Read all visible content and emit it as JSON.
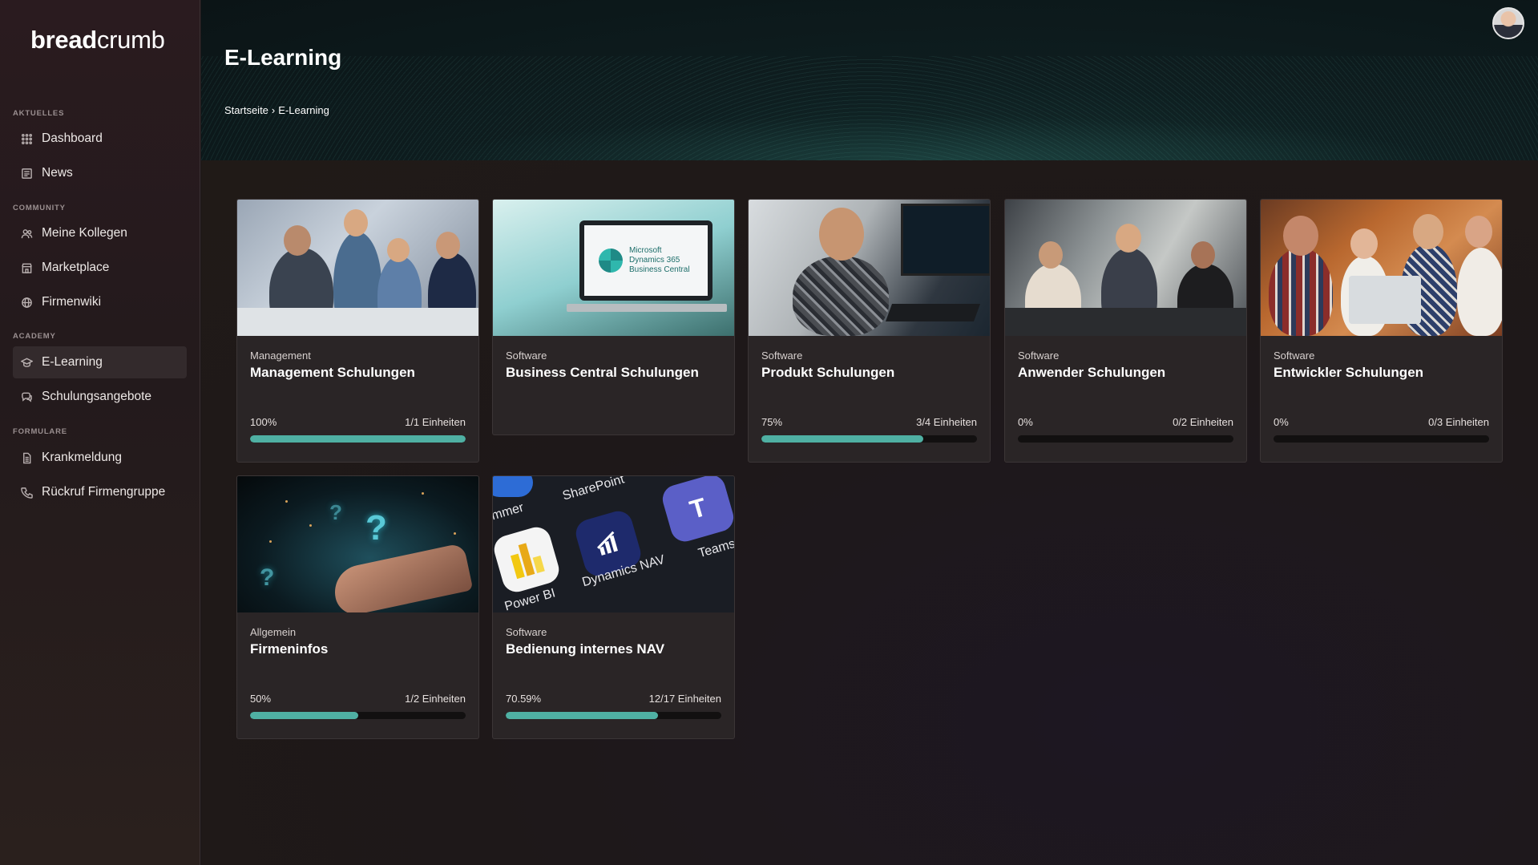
{
  "brand": {
    "bold": "bread",
    "light": "crumb"
  },
  "sidebar": {
    "sections": [
      {
        "label": "AKTUELLES"
      },
      {
        "label": "COMMUNITY"
      },
      {
        "label": "ACADEMY"
      },
      {
        "label": "FORMULARE"
      }
    ],
    "items": [
      {
        "label": "Dashboard",
        "icon": "grid-icon"
      },
      {
        "label": "News",
        "icon": "newspaper-icon"
      },
      {
        "label": "Meine Kollegen",
        "icon": "users-icon"
      },
      {
        "label": "Marketplace",
        "icon": "store-icon"
      },
      {
        "label": "Firmenwiki",
        "icon": "globe-icon"
      },
      {
        "label": "E-Learning",
        "icon": "graduation-cap-icon",
        "active": true
      },
      {
        "label": "Schulungsangebote",
        "icon": "chat-icon"
      },
      {
        "label": "Krankmeldung",
        "icon": "document-icon"
      },
      {
        "label": "Rückruf Firmengruppe",
        "icon": "phone-icon"
      }
    ]
  },
  "header": {
    "title": "E-Learning",
    "breadcrumb": {
      "home": "Startseite",
      "separator": "›",
      "current": "E-Learning"
    }
  },
  "courses": [
    {
      "category": "Management",
      "title": "Management Schulungen",
      "percent": "100%",
      "units": "1/1 Einheiten",
      "progress": 1.0
    },
    {
      "category": "Software",
      "title": "Business Central Schulungen",
      "percent": "",
      "units": "",
      "progress": null,
      "image_text": "Microsoft Dynamics 365 Business Central"
    },
    {
      "category": "Software",
      "title": "Produkt Schulungen",
      "percent": "75%",
      "units": "3/4 Einheiten",
      "progress": 0.75
    },
    {
      "category": "Software",
      "title": "Anwender Schulungen",
      "percent": "0%",
      "units": "0/2 Einheiten",
      "progress": 0.0
    },
    {
      "category": "Software",
      "title": "Entwickler Schulungen",
      "percent": "0%",
      "units": "0/3 Einheiten",
      "progress": 0.0
    },
    {
      "category": "Allgemein",
      "title": "Firmeninfos",
      "percent": "50%",
      "units": "1/2 Einheiten",
      "progress": 0.5
    },
    {
      "category": "Software",
      "title": "Bedienung internes NAV",
      "percent": "70.59%",
      "units": "12/17 Einheiten",
      "progress": 0.7059,
      "image_labels": [
        "mmer",
        "SharePoint",
        "Power BI",
        "Dynamics NAV",
        "Teams"
      ]
    }
  ],
  "colors": {
    "accent": "#4fb0a3",
    "card": "#2a2526",
    "sidebar": "#2a1b1f"
  }
}
